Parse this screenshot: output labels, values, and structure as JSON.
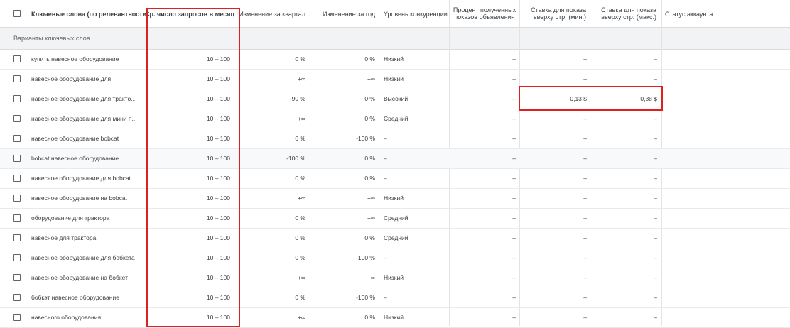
{
  "header": {
    "keywords": "Ключевые слова (по релевантности)",
    "avg_searches": "Ср. число запросов в месяц",
    "quarter_change": "Изменение за квартал",
    "year_change": "Изменение за год",
    "competition": "Уровень конкуренции",
    "impression_share_l1": "Процент полученных",
    "impression_share_l2": "показов объявления",
    "bid_low_l1": "Ставка для показа",
    "bid_low_l2": "вверху стр. (мин.)",
    "bid_high_l1": "Ставка для показа",
    "bid_high_l2": "вверху стр. (макс.)",
    "account_status": "Статус аккаунта"
  },
  "section_label": "Варианты ключевых слов",
  "rows": [
    {
      "keyword": "купить навесное оборудование",
      "avg": "10 – 100",
      "quarter": "0 %",
      "year": "0 %",
      "competition": "Низкий",
      "impr": "–",
      "bid_low": "–",
      "bid_high": "–"
    },
    {
      "keyword": "навесное оборудование для",
      "avg": "10 – 100",
      "quarter": "+∞",
      "year": "+∞",
      "competition": "Низкий",
      "impr": "–",
      "bid_low": "–",
      "bid_high": "–"
    },
    {
      "keyword": "навесное оборудование для тракто...",
      "avg": "10 – 100",
      "quarter": "-90 %",
      "year": "0 %",
      "competition": "Высокий",
      "impr": "–",
      "bid_low": "0,13 $",
      "bid_high": "0,38 $"
    },
    {
      "keyword": "навесное оборудование для мини п...",
      "avg": "10 – 100",
      "quarter": "+∞",
      "year": "0 %",
      "competition": "Средний",
      "impr": "–",
      "bid_low": "–",
      "bid_high": "–"
    },
    {
      "keyword": "навесное оборудование bobcat",
      "avg": "10 – 100",
      "quarter": "0 %",
      "year": "-100 %",
      "competition": "–",
      "impr": "–",
      "bid_low": "–",
      "bid_high": "–"
    },
    {
      "keyword": "bobcat навесное оборудование",
      "avg": "10 – 100",
      "quarter": "-100 %",
      "year": "0 %",
      "competition": "–",
      "impr": "–",
      "bid_low": "–",
      "bid_high": "–"
    },
    {
      "keyword": "навесное оборудование для bobcat",
      "avg": "10 – 100",
      "quarter": "0 %",
      "year": "0 %",
      "competition": "–",
      "impr": "–",
      "bid_low": "–",
      "bid_high": "–"
    },
    {
      "keyword": "навесное оборудование на bobcat",
      "avg": "10 – 100",
      "quarter": "+∞",
      "year": "+∞",
      "competition": "Низкий",
      "impr": "–",
      "bid_low": "–",
      "bid_high": "–"
    },
    {
      "keyword": "оборудование для трактора",
      "avg": "10 – 100",
      "quarter": "0 %",
      "year": "+∞",
      "competition": "Средний",
      "impr": "–",
      "bid_low": "–",
      "bid_high": "–"
    },
    {
      "keyword": "навесное для трактора",
      "avg": "10 – 100",
      "quarter": "0 %",
      "year": "0 %",
      "competition": "Средний",
      "impr": "–",
      "bid_low": "–",
      "bid_high": "–"
    },
    {
      "keyword": "навесное оборудование для бобкета",
      "avg": "10 – 100",
      "quarter": "0 %",
      "year": "-100 %",
      "competition": "–",
      "impr": "–",
      "bid_low": "–",
      "bid_high": "–"
    },
    {
      "keyword": "навесное оборудование на бобкет",
      "avg": "10 – 100",
      "quarter": "+∞",
      "year": "+∞",
      "competition": "Низкий",
      "impr": "–",
      "bid_low": "–",
      "bid_high": "–"
    },
    {
      "keyword": "бобкэт навесное оборудование",
      "avg": "10 – 100",
      "quarter": "0 %",
      "year": "-100 %",
      "competition": "–",
      "impr": "–",
      "bid_low": "–",
      "bid_high": "–"
    },
    {
      "keyword": "навесного оборудования",
      "avg": "10 – 100",
      "quarter": "+∞",
      "year": "0 %",
      "competition": "Низкий",
      "impr": "–",
      "bid_low": "–",
      "bid_high": "–"
    }
  ],
  "highlight_row_index": 5,
  "colors": {
    "highlight_box": "#e01f1f",
    "header_border": "#dadce0",
    "section_bg": "#f1f3f4"
  }
}
